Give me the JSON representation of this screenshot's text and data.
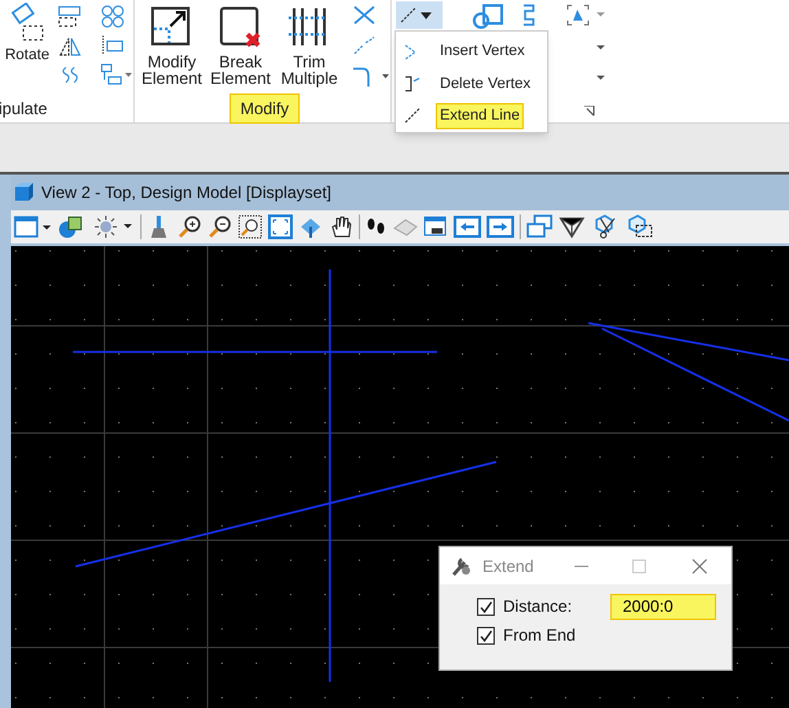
{
  "ribbon": {
    "manipulate_group": {
      "label": "ipulate",
      "tools": [
        {
          "label": "Rotate"
        }
      ]
    },
    "modify_group": {
      "label": "Modify",
      "highlighted": true,
      "tools": [
        {
          "label": "Modify Element",
          "kind": "modify"
        },
        {
          "label": "Break Element",
          "kind": "break"
        },
        {
          "label": "Trim Multiple",
          "kind": "trim"
        }
      ]
    }
  },
  "dropdown_menu": {
    "items": [
      {
        "label": "Insert Vertex",
        "highlighted": false
      },
      {
        "label": "Delete Vertex",
        "highlighted": false
      },
      {
        "label": "Extend Line",
        "highlighted": true
      }
    ]
  },
  "view": {
    "title": "View 2 - Top, Design Model [Displayset]"
  },
  "dialog": {
    "title": "Extend",
    "options": [
      {
        "label": "Distance:",
        "checked": true,
        "kind": "field",
        "value": "2000:0",
        "highlighted": true
      },
      {
        "label": "From End",
        "checked": true,
        "kind": "plain"
      }
    ]
  }
}
